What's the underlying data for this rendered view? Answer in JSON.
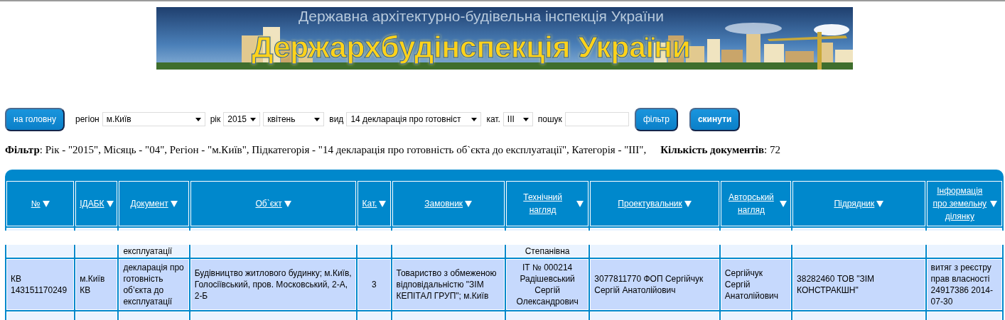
{
  "banner": {
    "subtitle": "Державна архітектурно-будівельна інспекція України",
    "title": "Держархбудінспекція України"
  },
  "toolbar": [
    {
      "kind": "button",
      "label": "на головну",
      "bold": false
    },
    {
      "kind": "select",
      "label": "регіон",
      "value": "м.Київ"
    },
    {
      "kind": "select",
      "label": "рік",
      "value": "2015"
    },
    {
      "kind": "select",
      "value": "квітень"
    },
    {
      "kind": "select",
      "label": "вид",
      "value": "14 декларація про готовніст"
    },
    {
      "kind": "select",
      "label": "кат.",
      "value": "III"
    },
    {
      "kind": "input",
      "label": "пошук"
    },
    {
      "kind": "button",
      "label": "фільтр",
      "bold": false
    },
    {
      "kind": "button",
      "label": "скинути",
      "bold": true
    }
  ],
  "filter_summary": "**Фільтр**: Рік - \"2015\", Місяць - \"04\", Регіон - \"м.Київ\", Підкатегорія - \"14 декларація про готовність об`єкта до експлуатації\", Категорія - \"III\",",
  "document_count": "**Кількість документів**: 72",
  "table": {
    "columns": [
      "№",
      "ІДАБК",
      "Документ",
      "Об`єкт",
      "Кат.",
      "Замовник",
      "Технічний нагляд",
      "Проектувальник",
      "Авторський нагляд",
      "Підрядник",
      "Інформація про земельну ділянку"
    ],
    "rows": [
      {
        "selected": false,
        "cells": [
          null,
          null,
          "експлуатації",
          null,
          null,
          null,
          "Степанівна",
          null,
          null,
          null,
          null
        ]
      },
      {
        "selected": true,
        "cells": [
          "КВ 143151170249",
          "м.Київ КВ",
          "декларація про готовність об’єкта до експлуатації",
          "Будівництво житлового будинку; м.Київ, Голосіївський, пров. Московський, 2-А, 2-Б",
          "3",
          "Товариство з обмеженою відповідальністю \"ЗІМ КЕПІТАЛ ГРУП\"; м.Київ",
          "ІТ № 000214 Радішевський Сергій Олександрович",
          "3077811770 ФОП Сергійчук Сергій Анатолійович",
          "Сергійчук Сергій Анатолійович",
          "38282460 ТОВ \"ЗІМ КОНСТРАКШН\"",
          "витяг з реєстру прав власності 24917386 2014-07-30"
        ]
      },
      {
        "selected": false,
        "cells": [
          null,
          null,
          null,
          null,
          null,
          null,
          null,
          null,
          null,
          null,
          null
        ]
      }
    ]
  }
}
